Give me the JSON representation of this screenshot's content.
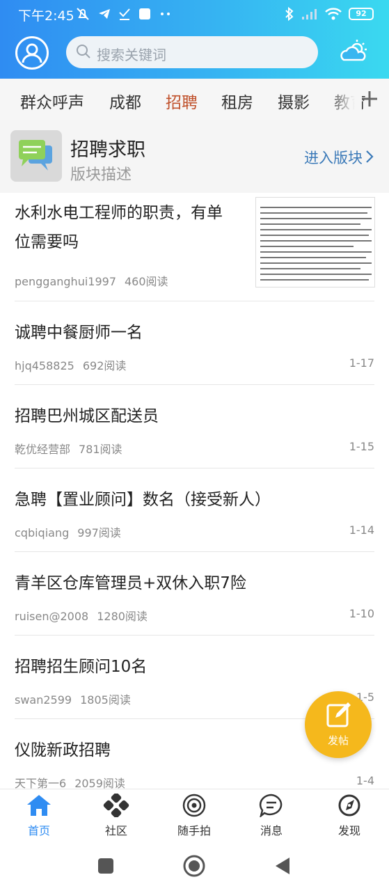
{
  "status": {
    "time": "下午2:45",
    "battery": "92"
  },
  "search": {
    "placeholder": "搜索关键词"
  },
  "tabs": [
    "群众呼声",
    "成都",
    "招聘",
    "租房",
    "摄影",
    "教育"
  ],
  "active_tab": "招聘",
  "board": {
    "title": "招聘求职",
    "description": "版块描述",
    "enter_label": "进入版块"
  },
  "posts": [
    {
      "title": "水利水电工程师的职责，有单位需要吗",
      "author": "pengganghui1997",
      "reads": "460阅读",
      "date": ""
    },
    {
      "title": "诚聘中餐厨师一名",
      "author": "hjq458825",
      "reads": "692阅读",
      "date": "1-17"
    },
    {
      "title": "招聘巴州城区配送员",
      "author": "乾优经营部",
      "reads": "781阅读",
      "date": "1-15"
    },
    {
      "title": "急聘【置业顾问】数名（接受新人）",
      "author": "cqbiqiang",
      "reads": "997阅读",
      "date": "1-14"
    },
    {
      "title": "青羊区仓库管理员+双休入职7险",
      "author": "ruisen@2008",
      "reads": "1280阅读",
      "date": "1-10"
    },
    {
      "title": "招聘招生顾问10名",
      "author": "swan2599",
      "reads": "1805阅读",
      "date": "1-5"
    },
    {
      "title": "仪陇新政招聘",
      "author": "天下第一6",
      "reads": "2059阅读",
      "date": "1-4"
    }
  ],
  "fab": {
    "label": "发帖"
  },
  "nav": [
    "首页",
    "社区",
    "随手拍",
    "消息",
    "发现"
  ],
  "colors": {
    "accent": "#2f8cf2",
    "active_tab": "#c0502a",
    "fab": "#f5b81c"
  }
}
